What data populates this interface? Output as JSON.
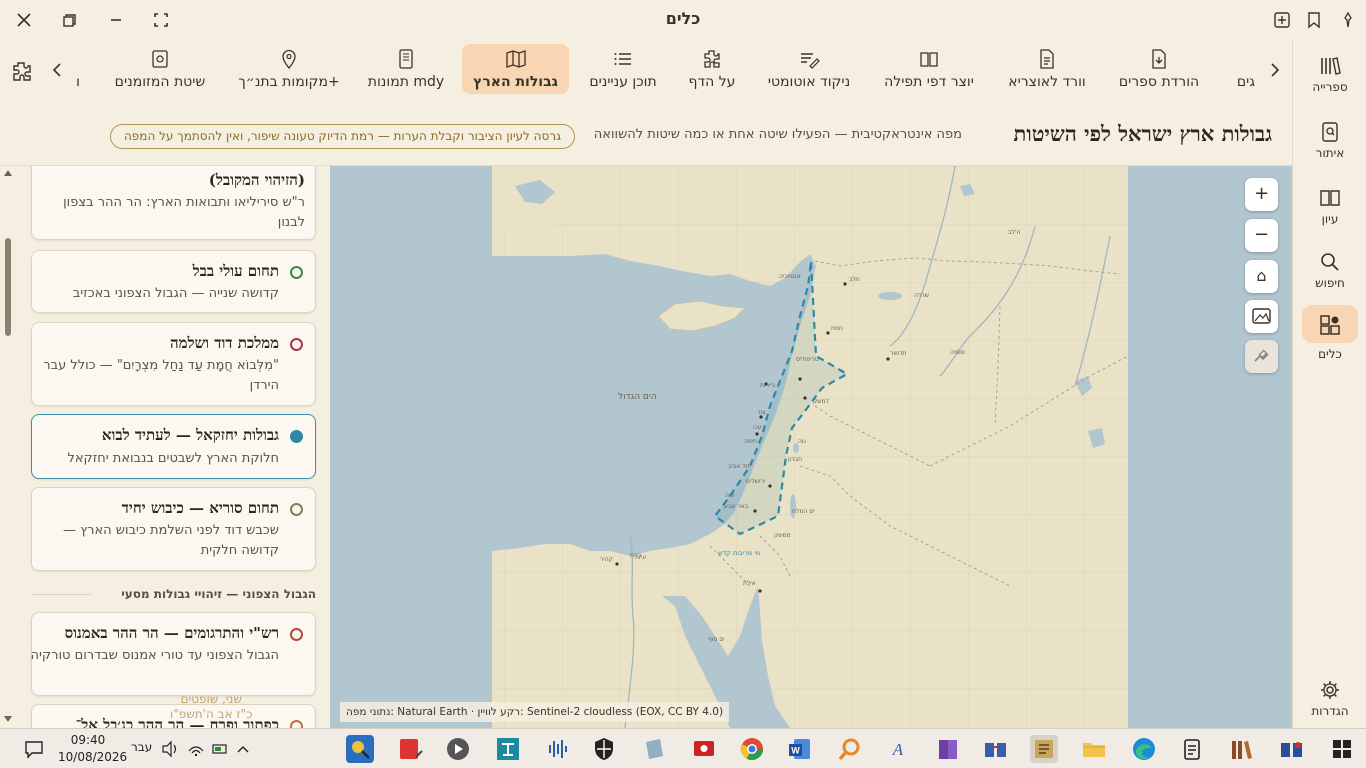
{
  "app": {
    "title": "כלים"
  },
  "rail": {
    "items": [
      {
        "label": "ספרייה",
        "icon": "library-icon"
      },
      {
        "label": "איתור",
        "icon": "locate-icon"
      },
      {
        "label": "עיון",
        "icon": "book-open-icon"
      },
      {
        "label": "חיפוש",
        "icon": "search-icon"
      },
      {
        "label": "כלים",
        "icon": "tools-icon",
        "active": true
      },
      {
        "label": "הגדרות",
        "icon": "gear-icon"
      }
    ]
  },
  "toolbar": {
    "tools": [
      {
        "label": "גים",
        "icon": ""
      },
      {
        "label": "הורדת ספרים",
        "icon": "download-doc-icon"
      },
      {
        "label": "וורד לאוצריא",
        "icon": "document-icon"
      },
      {
        "label": "יוצר דפי תפילה",
        "icon": "book-icon"
      },
      {
        "label": "ניקוד אוטומטי",
        "icon": "text-edit-icon"
      },
      {
        "label": "על הדף",
        "icon": "puzzle-icon"
      },
      {
        "label": "תוכן עניינים",
        "icon": "list-icon"
      },
      {
        "label": "גבולות הארץ",
        "icon": "map-icon",
        "active": true
      },
      {
        "label": "תמונות mdy",
        "icon": "tablet-icon"
      },
      {
        "label": "מקומות בתנ״ך+",
        "icon": "pin-icon"
      },
      {
        "label": "שיטת המזומנים",
        "icon": "safe-icon"
      },
      {
        "label": "ו",
        "icon": ""
      }
    ]
  },
  "header": {
    "title": "גבולות ארץ ישראל לפי השיטות",
    "subtitle": "מפה אינטראקטיבית — הפעילו שיטה אחת או כמה שיטות להשוואה",
    "badge": "גרסה לעיון הציבור וקבלת הערות — רמת הדיוק טעונה שיפור, ואין להסתמך על המפה"
  },
  "panel": {
    "cards": [
      {
        "title": "(הזיהוי המקובל)",
        "desc": "ר\"ש סיריליאו ותבואות הארץ: הר ההר בצפון לבנון",
        "dot_color": "",
        "selected": false
      },
      {
        "title": "תחום עולי בבל",
        "desc": "קדושה שנייה — הגבול הצפוני באכזיב",
        "dot_color": "#3c8a46",
        "selected": false
      },
      {
        "title": "ממלכת דוד ושלמה",
        "desc": "\"מִלְּבוֹא חֲמָת עַד נַחַל מִצְרָיִם\" — כולל עבר הירדן",
        "dot_color": "#a83848",
        "selected": false
      },
      {
        "title": "גבולות יחזקאל — לעתיד לבוא",
        "desc": "חלוקת הארץ לשבטים בנבואת יחזקאל",
        "dot_color": "#2e88a6",
        "selected": true
      },
      {
        "title": "תחום סוריא — כיבוש יחיד",
        "desc": "שכבש דוד לפני השלמת כיבוש הארץ — קדושה חלקית",
        "dot_color": "#8a7a5e",
        "selected": false
      },
      {
        "title": "רש\"י והתרגומים — הר ההר באמנוס",
        "desc": "הגבול הצפוני עד טורי אמנוס שבדרום טורקיה",
        "dot_color": "#b8463a",
        "selected": false
      },
      {
        "title": "כפתור ופרח — הר ההר כג׳בל אל־",
        "desc": "",
        "dot_color": "#c4703a",
        "selected": false
      }
    ],
    "section_heading": "הגבול הצפוני — זיהויי גבולות מסעי",
    "overlay_text": [
      "שני, שופטים",
      "כ\"ז אב ה'תשפ\"ו"
    ]
  },
  "map": {
    "zoom_in": "+",
    "zoom_out": "−",
    "home": "⌂",
    "attribution": "נתוני מפה: Natural Earth · רקע לוויין: Sentinel-2 cloudless (EOX, CC BY 4.0)",
    "sea_label": "הים הגדול",
    "places": [
      "אנטיוכיה",
      "חלב",
      "חמת",
      "תדמור",
      "טריפוליס",
      "דמשק",
      "ביירות",
      "צור",
      "עכו",
      "חיפה",
      "נוה",
      "תל אביב",
      "ירושלים",
      "עזה",
      "באר שבע",
      "ים המלח",
      "ממשק",
      "חברון",
      "רפת",
      "קהיר",
      "אילת",
      "ים סוף",
      "מי מריבות קדש",
      "עיזה",
      "ח'לב",
      "שרדה",
      "סוסיה"
    ],
    "colors": {
      "sea": "#b2c6cf",
      "land": "#eae2c6",
      "border": "#2e88a6"
    }
  },
  "taskbar": {
    "time": "09:40",
    "date": "10/08/2026",
    "lang": "עבר"
  }
}
